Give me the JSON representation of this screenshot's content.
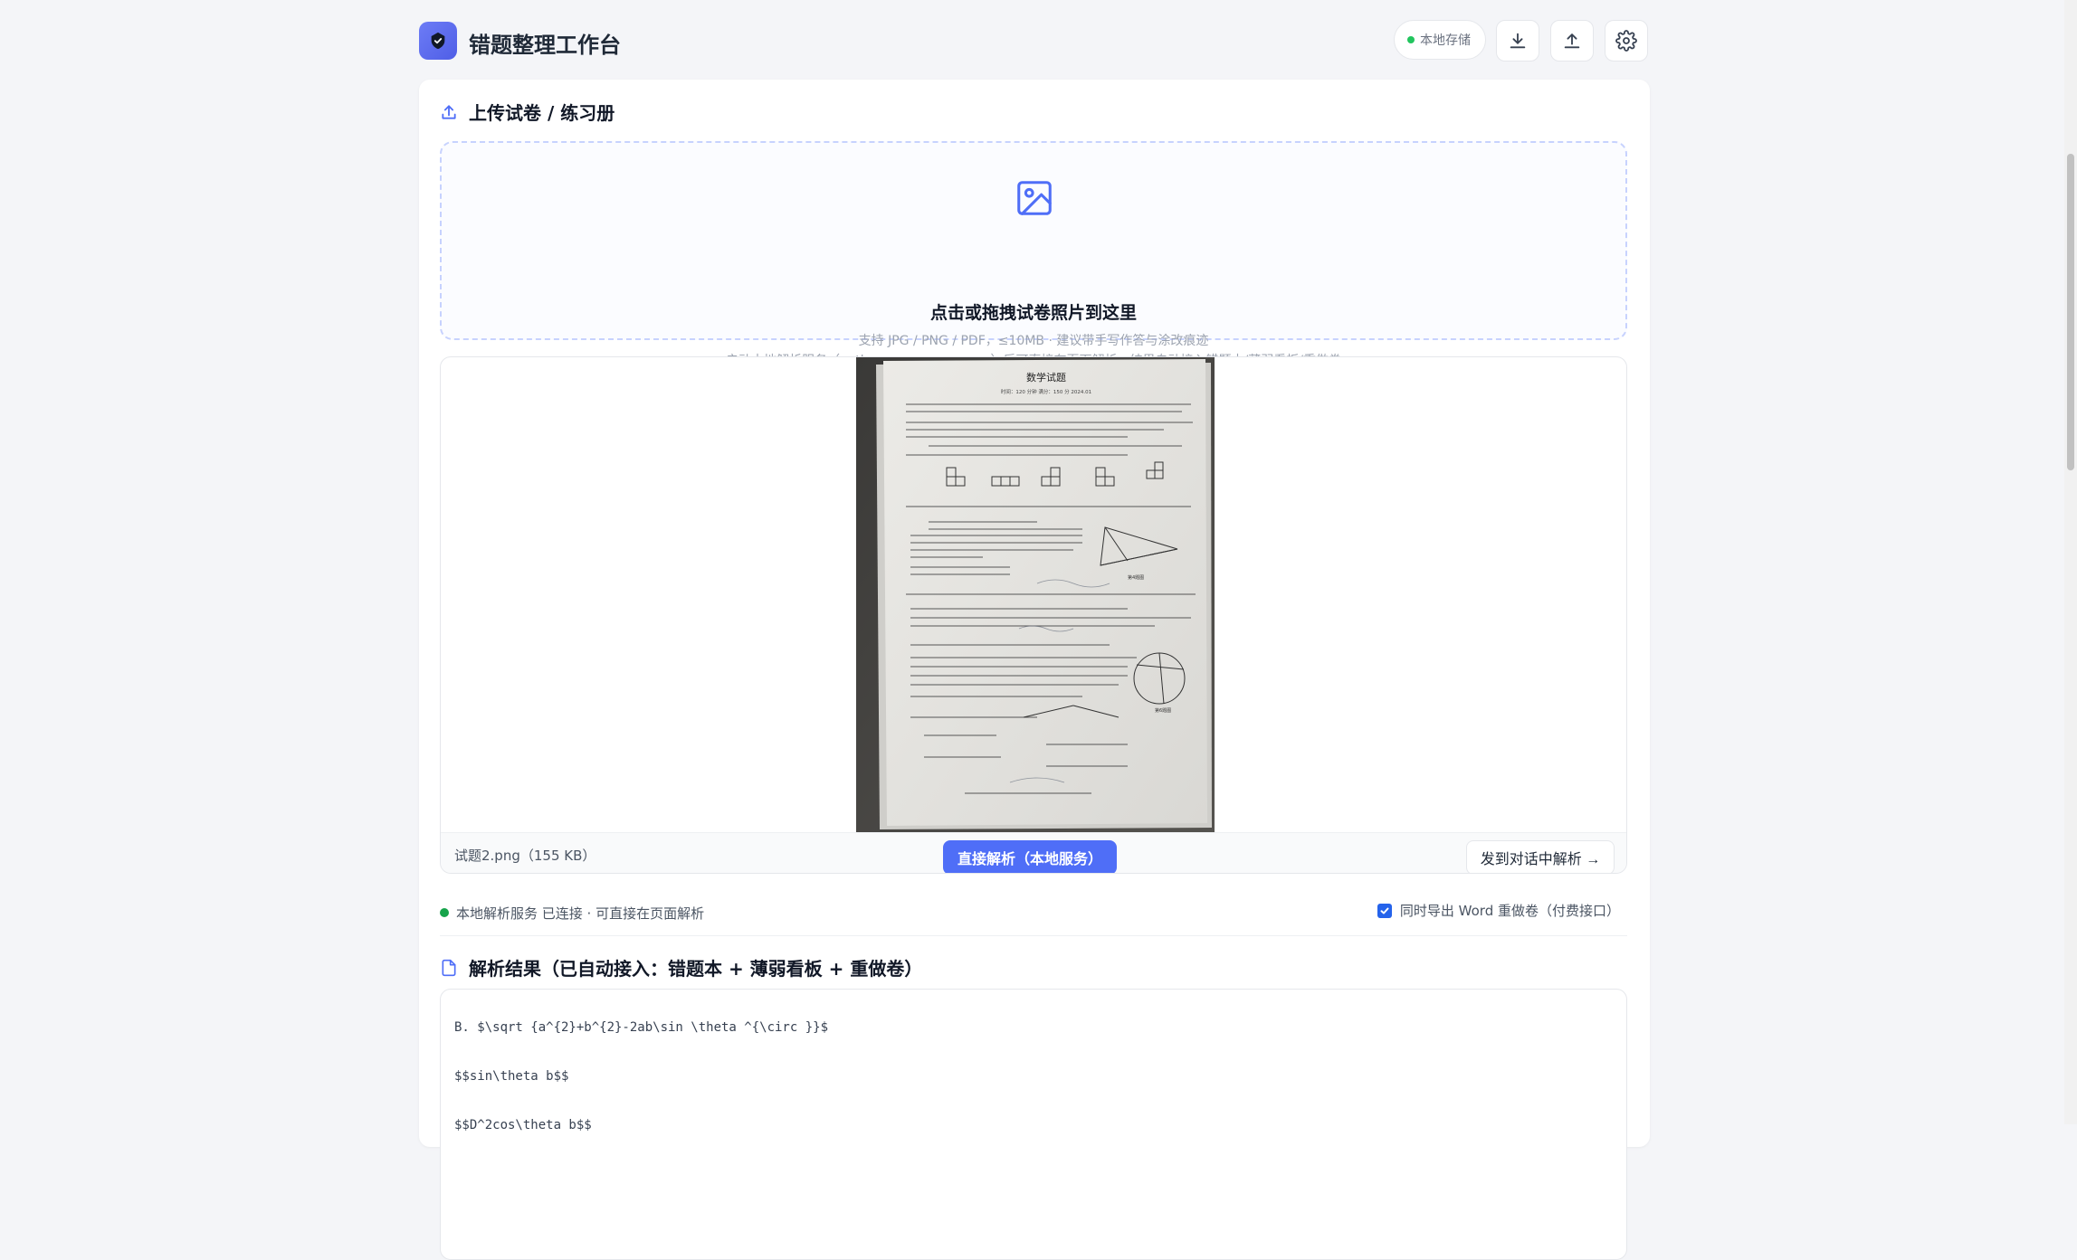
{
  "app": {
    "title": "错题整理工作台",
    "storage_badge": "本地存储",
    "icons": [
      "download-icon",
      "upload-icon",
      "gear-icon"
    ]
  },
  "upload_section": {
    "heading": "上传试卷 / 练习册",
    "dropzone_title": "点击或拖拽试卷照片到这里",
    "dropzone_hint_formats": "支持 JPG / PNG / PDF，≤10MB · 建议带手写作答与涂改痕迹",
    "dropzone_hint_service": "启动本地解析服务（python xparse_proxy.py）后可直接在页面解析，结果自动接入错题本/薄弱看板/重做卷"
  },
  "preview": {
    "image_text": {
      "title": "数学试题",
      "subtitle": "时间：120 分钟   满分：150 分        2024.01",
      "fig_label": "第4题图",
      "fig_label_2": "第6题图"
    },
    "file_label": "试题2.png（155 KB）",
    "parse_button": "直接解析（本地服务）",
    "chat_button": "发到对话中解析 →"
  },
  "service": {
    "status_text": "本地解析服务 已连接 · 可直接在页面解析",
    "word_export_label": "同时导出 Word 重做卷（付费接口）",
    "word_export_checked": true
  },
  "result_section": {
    "heading": "解析结果（已自动接入：错题本 + 薄弱看板 + 重做卷）",
    "lines": [
      "B. $\\sqrt {a^{2}+b^{2}-2ab\\sin \\theta ^{\\circ }}$",
      "$$sin\\theta b$$",
      "$$D^2cos\\theta b$$"
    ]
  },
  "colors": {
    "accent": "#4f6ef7",
    "connected": "#16a34a",
    "dashed_border": "#c7d2fe"
  }
}
